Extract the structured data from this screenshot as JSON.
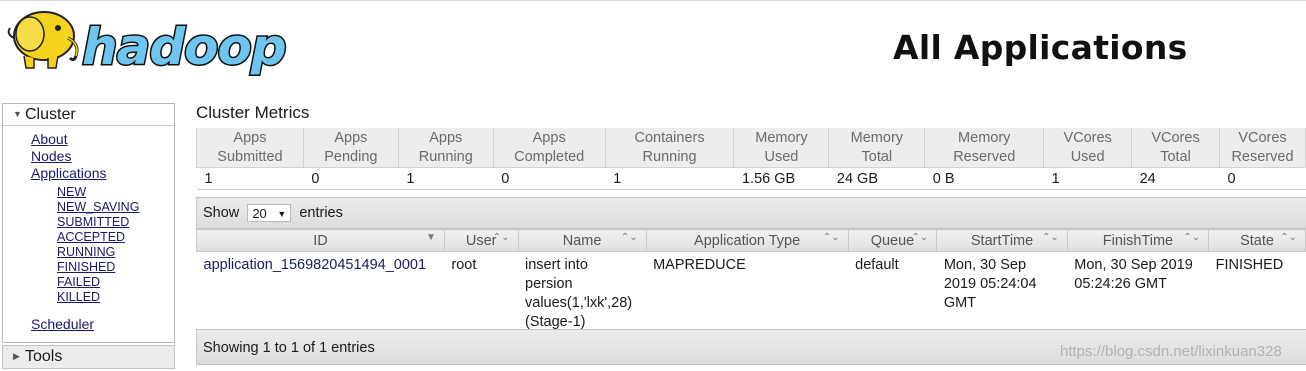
{
  "header": {
    "logo_text": "hadoop",
    "title": "All Applications"
  },
  "sidebar": {
    "cluster_label": "Cluster",
    "cluster_links": [
      "About",
      "Nodes",
      "Applications"
    ],
    "app_states": [
      "NEW",
      "NEW_SAVING",
      "SUBMITTED",
      "ACCEPTED",
      "RUNNING",
      "FINISHED",
      "FAILED",
      "KILLED"
    ],
    "scheduler_label": "Scheduler",
    "tools_label": "Tools"
  },
  "metrics": {
    "heading": "Cluster Metrics",
    "headers": [
      [
        "Apps",
        "Submitted"
      ],
      [
        "Apps",
        "Pending"
      ],
      [
        "Apps",
        "Running"
      ],
      [
        "Apps",
        "Completed"
      ],
      [
        "Containers",
        "Running"
      ],
      [
        "Memory",
        "Used"
      ],
      [
        "Memory",
        "Total"
      ],
      [
        "Memory",
        "Reserved"
      ],
      [
        "VCores",
        "Used"
      ],
      [
        "VCores",
        "Total"
      ],
      [
        "VCores",
        "Reserved"
      ]
    ],
    "values": [
      "1",
      "0",
      "1",
      "0",
      "1",
      "1.56 GB",
      "24 GB",
      "0 B",
      "1",
      "24",
      "0"
    ]
  },
  "apps": {
    "show_label": "Show",
    "entries_label": "entries",
    "page_length": "20",
    "columns": [
      "ID",
      "User",
      "Name",
      "Application Type",
      "Queue",
      "StartTime",
      "FinishTime",
      "State"
    ],
    "rows": [
      {
        "id": "application_1569820451494_0001",
        "user": "root",
        "name": "insert into persion values(1,'lxk',28) (Stage-1)",
        "type": "MAPREDUCE",
        "queue": "default",
        "start": "Mon, 30 Sep 2019 05:24:04 GMT",
        "finish": "Mon, 30 Sep 2019 05:24:26 GMT",
        "state": "FINISHED"
      }
    ],
    "info": "Showing 1 to 1 of 1 entries"
  },
  "watermark": "https://blog.csdn.net/lixinkuan328",
  "colors": {
    "logo_fill": "#6ec6f0",
    "logo_outline": "#101010",
    "elephant": "#f4d21e"
  }
}
